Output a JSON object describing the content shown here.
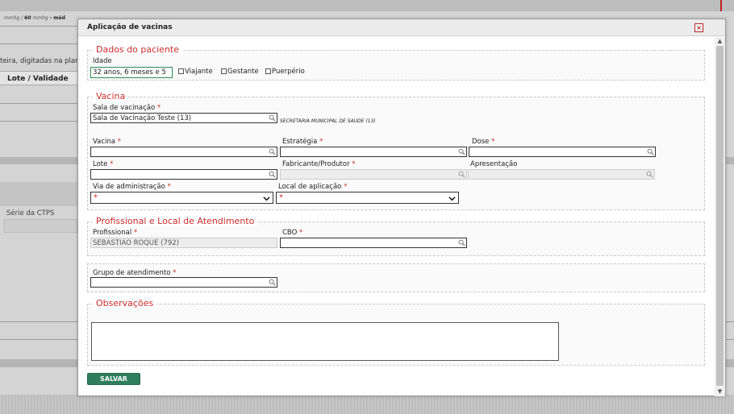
{
  "background": {
    "mmhg_a": "mmhg",
    "mmhg_value": "60",
    "mmhg_b": "mmhg",
    "mmhg_suffix": "- méd",
    "plan_text": "teira, digitadas na plan",
    "lote_header": "Lote / Validade",
    "serie_label": "Série da CTPS"
  },
  "modal": {
    "title": "Aplicação de vacinas",
    "close_symbol": "×"
  },
  "paciente": {
    "legend": "Dados do paciente",
    "idade_label": "Idade",
    "idade_value": "32 anos, 6 meses e 5",
    "checks": [
      "Viajante",
      "Gestante",
      "Puerpério"
    ]
  },
  "vacina": {
    "legend": "Vacina",
    "sala_label": "Sala de vacinação",
    "sala_value": "Sala de Vacinação Teste (13)",
    "sala_note": "SECRETARIA MUNICIPAL DE SAUDE (13)",
    "vacina_label": "Vacina",
    "estrategia_label": "Estratégia",
    "dose_label": "Dose",
    "lote_label": "Lote",
    "fabricante_label": "Fabricante/Produtor",
    "apresentacao_label": "Apresentação",
    "via_label": "Via de administração",
    "local_label": "Local de aplicação"
  },
  "profissional": {
    "legend": "Profissional e Local de Atendimento",
    "prof_label": "Profissional",
    "prof_value": "SEBASTIAO ROQUE (792)",
    "cbo_label": "CBO"
  },
  "grupo": {
    "label": "Grupo de atendimento"
  },
  "observacoes": {
    "legend": "Observações"
  },
  "actions": {
    "save_label": "SALVAR"
  },
  "required_mark": "*",
  "colors": {
    "legend_red": "#cc2a2a",
    "save_green": "#2e7d5b"
  }
}
